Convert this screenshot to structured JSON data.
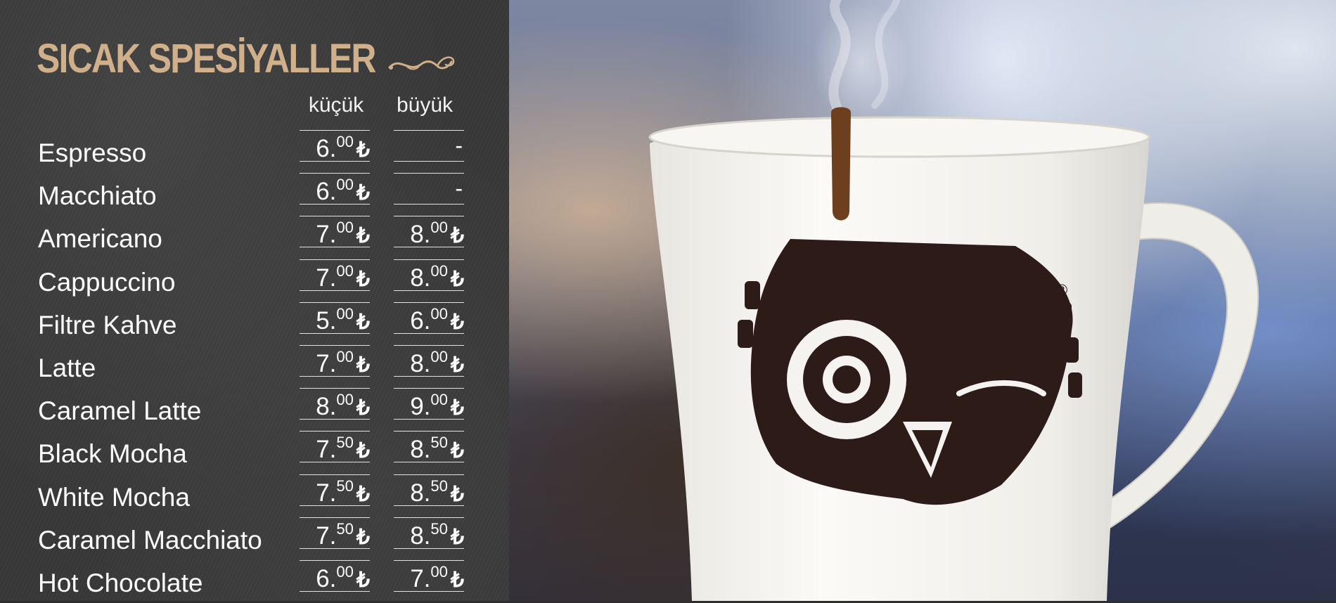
{
  "menu": {
    "title": "SICAK SPESİYALLER",
    "col_small": "küçük",
    "col_large": "büyük",
    "currency": "₺",
    "items": [
      {
        "name": "Espresso",
        "small_int": "6.",
        "small_dec": "00",
        "large_int": "",
        "large_dec": "",
        "large_dash": "-"
      },
      {
        "name": "Macchiato",
        "small_int": "6.",
        "small_dec": "00",
        "large_int": "",
        "large_dec": "",
        "large_dash": "-"
      },
      {
        "name": "Americano",
        "small_int": "7.",
        "small_dec": "00",
        "large_int": "8.",
        "large_dec": "00",
        "large_dash": ""
      },
      {
        "name": "Cappuccino",
        "small_int": "7.",
        "small_dec": "00",
        "large_int": "8.",
        "large_dec": "00",
        "large_dash": ""
      },
      {
        "name": "Filtre Kahve",
        "small_int": "5.",
        "small_dec": "00",
        "large_int": "6.",
        "large_dec": "00",
        "large_dash": ""
      },
      {
        "name": "Latte",
        "small_int": "7.",
        "small_dec": "00",
        "large_int": "8.",
        "large_dec": "00",
        "large_dash": ""
      },
      {
        "name": "Caramel Latte",
        "small_int": "8.",
        "small_dec": "00",
        "large_int": "9.",
        "large_dec": "00",
        "large_dash": ""
      },
      {
        "name": "Black Mocha",
        "small_int": "7.",
        "small_dec": "50",
        "large_int": "8.",
        "large_dec": "50",
        "large_dash": ""
      },
      {
        "name": "White Mocha",
        "small_int": "7.",
        "small_dec": "50",
        "large_int": "8.",
        "large_dec": "50",
        "large_dash": ""
      },
      {
        "name": "Caramel Macchiato",
        "small_int": "7.",
        "small_dec": "50",
        "large_int": "8.",
        "large_dec": "50",
        "large_dash": ""
      },
      {
        "name": "Hot Chocolate",
        "small_int": "6.",
        "small_dec": "00",
        "large_int": "7.",
        "large_dec": "00",
        "large_dash": ""
      }
    ]
  },
  "photo": {
    "mug_logo_mark": "®",
    "mug_color": "#f3f1ec",
    "logo_color": "#2d1b18"
  },
  "colors": {
    "title": "#cfb08a",
    "board": "#383838",
    "text": "#ffffff"
  }
}
